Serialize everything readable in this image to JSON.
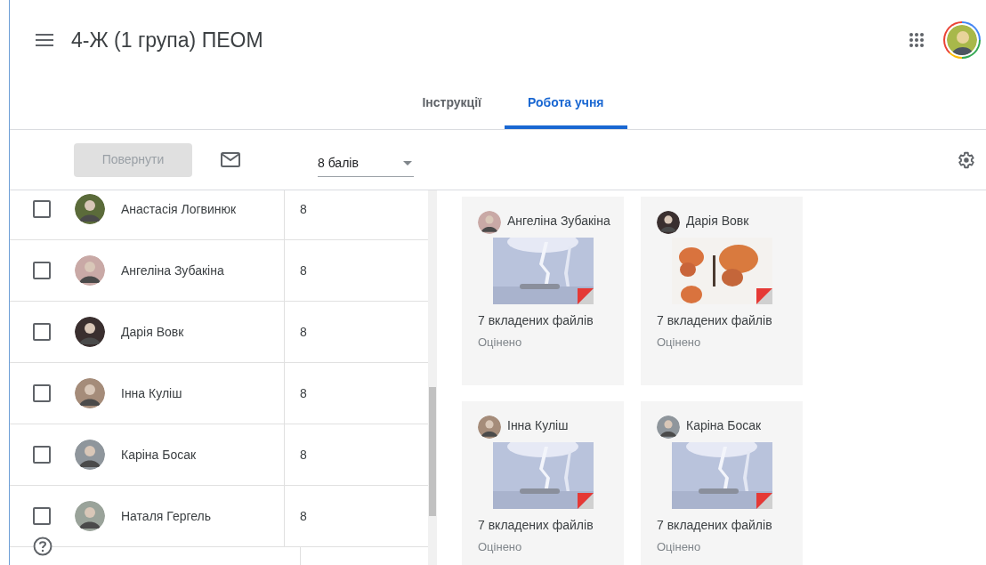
{
  "class_title": "4-Ж (1 група) ПЕОМ",
  "tabs": [
    {
      "label": "Інструкції",
      "selected": false
    },
    {
      "label": "Робота учня",
      "selected": true
    }
  ],
  "toolbar": {
    "return_button": {
      "label": "Повернути",
      "disabled": true
    },
    "points_select": {
      "value": "8 балів"
    }
  },
  "students": [
    {
      "name": "Анастасія Логвинюк",
      "grade": "8",
      "checked": false
    },
    {
      "name": "Ангеліна Зубакіна",
      "grade": "8",
      "checked": false
    },
    {
      "name": "Дарія Вовк",
      "grade": "8",
      "checked": false
    },
    {
      "name": "Інна Куліш",
      "grade": "8",
      "checked": false
    },
    {
      "name": "Каріна Босак",
      "grade": "8",
      "checked": false
    },
    {
      "name": "Наталя Гергель",
      "grade": "8",
      "checked": false
    }
  ],
  "submissions": [
    {
      "name": "Ангеліна Зубакіна",
      "attachments": "7 вкладених файлів",
      "status": "Оцінено"
    },
    {
      "name": "Дарія Вовк",
      "attachments": "7 вкладених файлів",
      "status": "Оцінено"
    },
    {
      "name": "Інна Куліш",
      "attachments": "7 вкладених файлів",
      "status": "Оцінено"
    },
    {
      "name": "Каріна Босак",
      "attachments": "7 вкладених файлів",
      "status": "Оцінено"
    }
  ]
}
